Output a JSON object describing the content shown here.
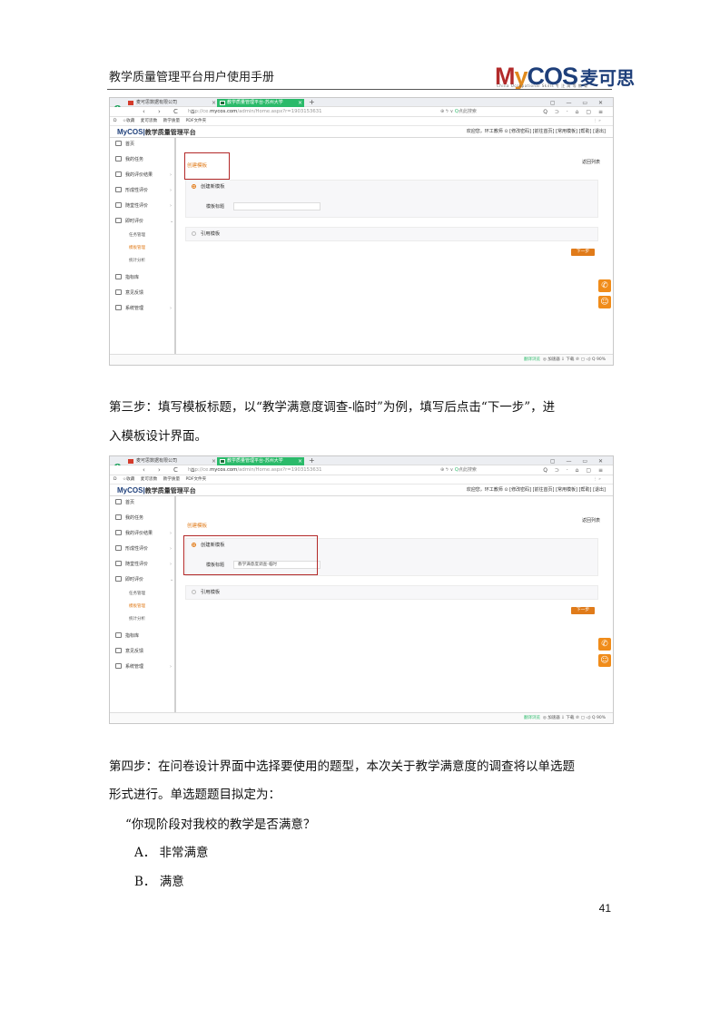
{
  "header": {
    "doc_title": "教学质量管理平台用户使用手册"
  },
  "logo": {
    "my_m": "M",
    "my_y": "y",
    "my_cos": "COS",
    "cn": "麦可思",
    "subtitle": "China Occupational Skills  专 注 高 等 教 育"
  },
  "screenshot1": {
    "browser": {
      "tab1": "麦可思数据有限公司",
      "tab2": "教学质量管理平台-苏州大学",
      "tab_close": "×",
      "tab_new": "+",
      "window_controls": "▢ — ▭ ✕",
      "nav": "‹ › C ⌂",
      "url_prefix": "http://ce.",
      "url_domain": "mycos.com",
      "url_path": "/admin/Home.aspx?r=1903153631",
      "search_prefix": "⊕ ϟ ∨",
      "search_engine": "Q",
      "search_text": "点此搜索",
      "addr_right": "Q ⊃ · ⌂ ▢ ≡",
      "bookmarks": [
        "D",
        "☆收藏",
        "麦可思数",
        "教学质量",
        "PDF文件夹"
      ],
      "bookmarks_right": "⋮  »"
    },
    "app": {
      "logo": "MyCOS",
      "logo_sep": "|",
      "platform": "教学质量管理平台",
      "user_bar": "欢迎您，环工教师 ⊙   [修改密码]  [前往首页]  [常用模板]  [帮助]  [退出]"
    },
    "sidebar": {
      "items": [
        {
          "label": "首页"
        },
        {
          "label": "我的任务"
        },
        {
          "label": "我的评价结果",
          "chevron": "›"
        },
        {
          "label": "形成性评价",
          "chevron": "›"
        },
        {
          "label": "随堂性评价",
          "chevron": "›"
        },
        {
          "label": "即时评价",
          "chevron": "⌄"
        }
      ],
      "subitems": [
        "任务管理",
        "模板管理",
        "统计分析"
      ],
      "items2": [
        {
          "label": "指标库"
        },
        {
          "label": "意见反馈"
        },
        {
          "label": "系统管理",
          "chevron": "›"
        }
      ]
    },
    "content": {
      "breadcrumb": "创建模板",
      "back": "返回列表",
      "option_new": "创建新模板",
      "field_label": "模板标题",
      "field_value": "",
      "option_ref": "引用模板",
      "next": "下一步"
    },
    "status": {
      "left": "加速器",
      "text": "◎ 加速器  ⇩ 下载  ℗  ▢  ◁)  Q 90%",
      "pill": "翻译浏览"
    }
  },
  "para1": {
    "line1": "第三步：填写模板标题，以“教学满意度调查-临时”为例，填写后点击“下一步”，进",
    "line2": "入模板设计界面。"
  },
  "screenshot2": {
    "content": {
      "breadcrumb": "创建模板",
      "back": "返回列表",
      "option_new": "创建新模板",
      "field_label": "模板标题",
      "field_value": "教学满意度调查-临时",
      "option_ref": "引用模板",
      "next": "下一步"
    }
  },
  "para2": {
    "line1": "第四步：在问卷设计界面中选择要使用的题型，本次关于教学满意度的调查将以单选题",
    "line2": "形式进行。单选题题目拟定为：",
    "line3": "“你现阶段对我校的教学是否满意？",
    "line4": "A．  非常满意",
    "line5": "B．  满意"
  },
  "page": {
    "number": "41"
  },
  "colors": {
    "accent": "#e07b1a",
    "highlight_box": "#b32828",
    "tab_green": "#2bba6a",
    "brand_blue": "#1e3f7a"
  }
}
